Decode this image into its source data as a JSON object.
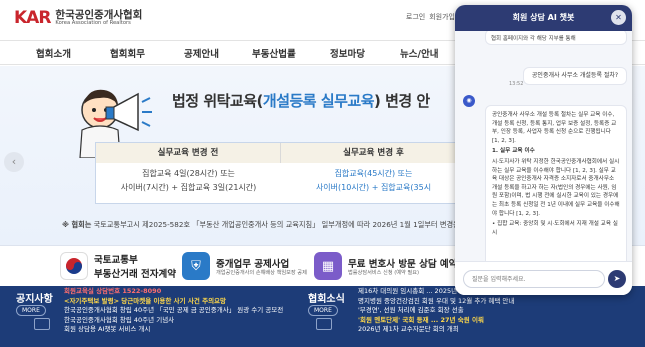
{
  "header": {
    "logo_mark": "KAR",
    "logo_name_ko": "한국공인중개사협회",
    "logo_name_en": "Korea Association of Realtors",
    "util": [
      "로그인",
      "회원가입",
      "사이트맵"
    ]
  },
  "nav": {
    "items": [
      "협회소개",
      "협회회무",
      "공제안내",
      "부동산법률",
      "정보마당",
      "뉴스/안내"
    ]
  },
  "banner": {
    "title_prefix": "법정 위탁교육(",
    "title_highlight": "개설등록 실무교육",
    "title_suffix": ") 변경 안",
    "table": {
      "head_left": "실무교육 변경 전",
      "head_right": "실무교육 변경 후",
      "left_lines": [
        "집합교육 4일(28시간) 또는",
        "사이버(7시간) + 집합교육 3일(21시간)"
      ],
      "right_lines": [
        "집합교육(45시간) 또는",
        "사이버(10시간) + 집합교육(35시"
      ]
    },
    "notice_bold": "※ 협회는",
    "notice_text": " 국토교통부고시 제2025-582호 「부동산 개업공인중개사 등의 교육지침」 일부개정에 따라 2026년 1월 1일부터 변경운영"
  },
  "quick_links": [
    {
      "title": "국토교통부",
      "sub": "부동산거래 전자계약",
      "icon": "gov-emblem-icon",
      "color": "#ffffff"
    },
    {
      "title": "중개업무 공제사업",
      "sub": "개업공인중개사의 손해배상 책임보장 공제",
      "icon": "shield-icon",
      "color": "#2a7ac7"
    },
    {
      "title": "무료 변호사 방문 상담 예약",
      "sub": "법률상담서비스 신청 (예약 필요)",
      "icon": "calendar-icon",
      "color": "#7b5cc9"
    }
  ],
  "notice": {
    "title": "공지사항",
    "more": "MORE",
    "items": [
      {
        "text": "회원교육실 상담번호 1522-8090",
        "style": "red"
      },
      {
        "text": "<자기주택보 발령> 당근마켓을 이용한 사기 사건 주의요망",
        "style": "yel"
      },
      {
        "text": "한국공인중개사협회 창립 40주년 「국민 공제 금 공인중개사」 원광 수기 공모전",
        "style": ""
      },
      {
        "text": "한국공인중개사협회 창립 40주년 기념사",
        "style": ""
      },
      {
        "text": "회원 상담용 AI챗봇 서비스 개시",
        "style": ""
      }
    ]
  },
  "news": {
    "title": "협회소식",
    "more": "MORE",
    "items": [
      {
        "text": "제16차 대의원 임시총회 ... 2025년 ...",
        "style": ""
      },
      {
        "text": "명지병원 중앙건강검진 회원 우대 및 12월 추가 혜택 안내",
        "style": ""
      },
      {
        "text": "'부경연', 선원 처리에 김준호 회장 선출",
        "style": ""
      },
      {
        "text": "'회원 멘토단제' 국회 등재 ... 27년 숙원 이뤄",
        "style": "yel"
      },
      {
        "text": "2026년 제1차 교수자문단 회의 개최",
        "style": ""
      }
    ]
  },
  "chat": {
    "title": "회원 상담 AI 챗봇",
    "close": "✕",
    "top_bubble": "협회 홈페이지와 각 해당 지부를 통해",
    "time": "13:52",
    "user_msg": "공인중개사 사무소 개설등록 절차?",
    "bot_paragraphs": [
      {
        "text": "공인중개사 사무소 개설 등록 절차는 실무 교육 이수, 개설 등록 신청, 등록 통지, 업무 보증 설정, 등록증 교부, 인장 등록, 사업자 등록 신청 순으로 진행됩니다 [1, 2, 3].",
        "bold": false
      },
      {
        "text": "1. 실무 교육 이수",
        "bold": true
      },
      {
        "text": "시·도지사가 위탁 지정한 한국공인중개사협회에서 실시하는 실무 교육을 이수해야 합니다 [1, 2, 3]. 실무 교육 대상은 공인중개사 자격증 소지자로서 중개사무소 개설 등록을 하고자 하는 자(법인의 경우에는 사원, 임원 포함)이며, 법 시행 전에 실시한 교육이 있는 경우에는 최초 등록 신청일 전 1년 이내에 실무 교육을 이수해야 합니다 [1, 2, 3].",
        "bold": false
      },
      {
        "text": "• 집합 교육: 중앙회 및 시·도회에서 지재 개설 교육 실시",
        "bold": false
      }
    ],
    "input_placeholder": "질문을 입력해주세요.",
    "send": "➤"
  },
  "colors": {
    "brand_red": "#c9252c",
    "brand_blue": "#1b3c8c",
    "chat_header": "#2d3b73",
    "highlight": "#2a7ac7",
    "footer_bg": "#1d3c78"
  }
}
